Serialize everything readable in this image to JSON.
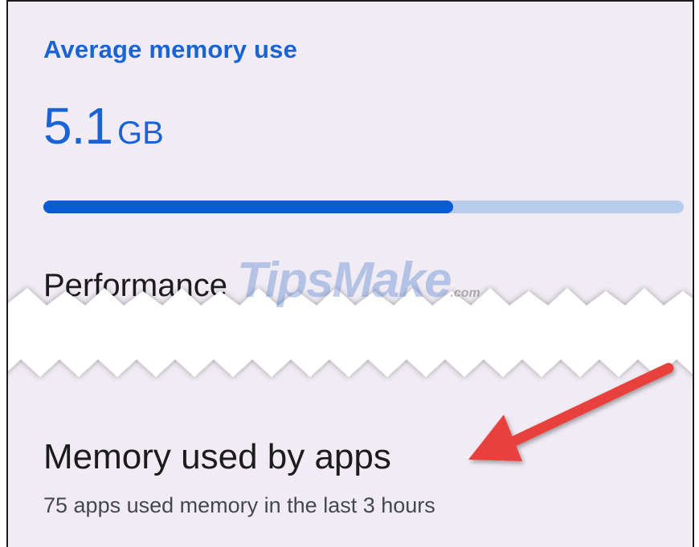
{
  "average_memory": {
    "title": "Average memory use",
    "value": "5.1",
    "unit": "GB",
    "usage_fraction": 0.64
  },
  "performance": {
    "title": "Performance"
  },
  "apps_memory": {
    "title": "Memory used by apps",
    "subtitle": "75 apps used memory in the last 3 hours"
  },
  "watermark": {
    "text": "TipsMake",
    "domain": ".com"
  },
  "colors": {
    "accent": "#1a63d6",
    "bar_fill": "#0b5bd3",
    "bar_track": "#b8ccec",
    "panel": "#f1ecf4",
    "arrow": "#e8403c"
  },
  "icons": [
    "red-arrow-annotation",
    "torn-paper-edge"
  ]
}
